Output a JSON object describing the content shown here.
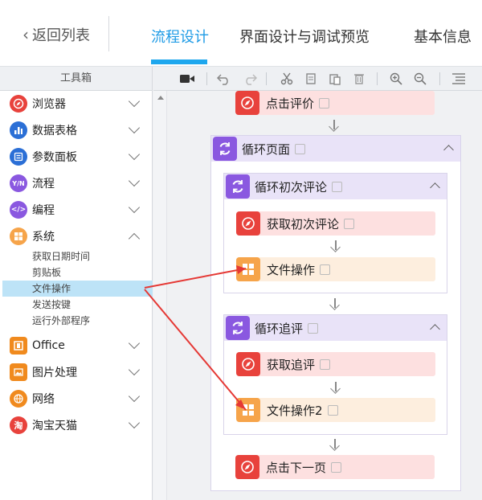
{
  "nav": {
    "back_label": "返回列表",
    "tabs": [
      "流程设计",
      "界面设计与调试预览",
      "基本信息"
    ]
  },
  "toolbox": {
    "title": "工具箱",
    "categories": [
      {
        "label": "浏览器",
        "icon": "compass-icon",
        "color": "#e8423c"
      },
      {
        "label": "数据表格",
        "icon": "bar-chart-icon",
        "color": "#2b6fd6"
      },
      {
        "label": "参数面板",
        "icon": "list-panel-icon",
        "color": "#2b6fd6"
      },
      {
        "label": "流程",
        "icon": "yn-icon",
        "color": "#8a58e0"
      },
      {
        "label": "编程",
        "icon": "code-icon",
        "color": "#8a58e0"
      },
      {
        "label": "系统",
        "icon": "grid-icon",
        "color": "#f6a44a"
      },
      {
        "label": "Office",
        "icon": "office-icon",
        "color": "#f08a1e"
      },
      {
        "label": "图片处理",
        "icon": "image-icon",
        "color": "#f08a1e"
      },
      {
        "label": "网络",
        "icon": "globe-icon",
        "color": "#f08a1e"
      },
      {
        "label": "淘宝天猫",
        "icon": "taobao-icon",
        "color": "#e8423c"
      }
    ],
    "system_items": [
      "获取日期时间",
      "剪贴板",
      "文件操作",
      "发送按键",
      "运行外部程序"
    ],
    "taobao_glyph": "淘"
  },
  "flow": {
    "click_review": "点击评价",
    "loop_page": "循环页面",
    "loop_first_review": "循环初次评论",
    "get_first_review": "获取初次评论",
    "file_op": "文件操作",
    "loop_followup": "循环追评",
    "get_followup": "获取追评",
    "file_op2": "文件操作2",
    "click_next": "点击下一页"
  },
  "colors": {
    "accent": "#1e9be6",
    "selected_bg": "#bde3f7",
    "red_node": "#fde0e0",
    "orange_node": "#fdeede",
    "loop_head": "#e9e3f8",
    "annotation_arrow": "#e53935"
  }
}
